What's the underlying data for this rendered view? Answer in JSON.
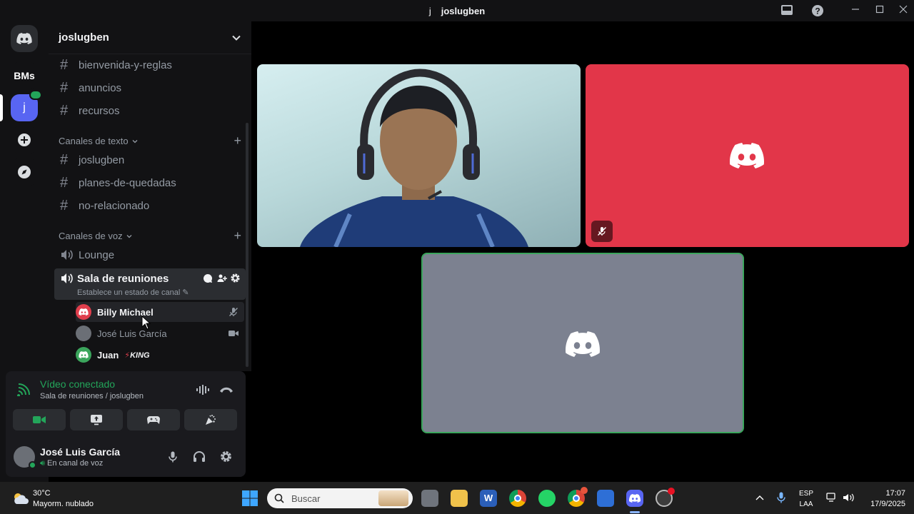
{
  "window": {
    "title": "joslugben",
    "title_glyph": "j"
  },
  "servers": [
    {
      "label": "BMs"
    },
    {
      "label": "j"
    }
  ],
  "guild": {
    "name": "joslugben"
  },
  "channels_top": [
    {
      "name": "bienvenida-y-reglas"
    },
    {
      "name": "anuncios"
    },
    {
      "name": "recursos"
    }
  ],
  "text_category": {
    "label": "Canales de texto",
    "channels": [
      {
        "name": "joslugben"
      },
      {
        "name": "planes-de-quedadas"
      },
      {
        "name": "no-relacionado"
      }
    ]
  },
  "voice_category": {
    "label": "Canales de voz",
    "lounge": "Lounge",
    "active": {
      "name": "Sala de reuniones",
      "status": "Establece un estado de canal"
    },
    "users": [
      {
        "name": "Billy Michael",
        "avatar_color": "#e03e4c"
      },
      {
        "name": "José Luis García",
        "avatar_color": "#6b6f76"
      },
      {
        "name": "Juan",
        "badge": "KING",
        "avatar_color": "#3ba55c"
      }
    ]
  },
  "voice_panel": {
    "status": "Vídeo conectado",
    "location": "Sala de reuniones / joslugben"
  },
  "user": {
    "name": "José Luis García",
    "status": "En canal de voz"
  },
  "stage_tiles": [
    {
      "kind": "camera"
    },
    {
      "kind": "avatar",
      "color": "#e23649"
    },
    {
      "kind": "avatar",
      "color": "#7c8190"
    }
  ],
  "taskbar": {
    "weather_temp": "30°C",
    "weather_desc": "Mayorm. nublado",
    "search_placeholder": "Buscar",
    "lang_top": "ESP",
    "lang_bottom": "LAA",
    "time": "17:07",
    "date": "17/9/2025"
  },
  "colors": {
    "accent": "#5865f2",
    "connected": "#23a55a",
    "speaking_border": "#3ba55c"
  }
}
